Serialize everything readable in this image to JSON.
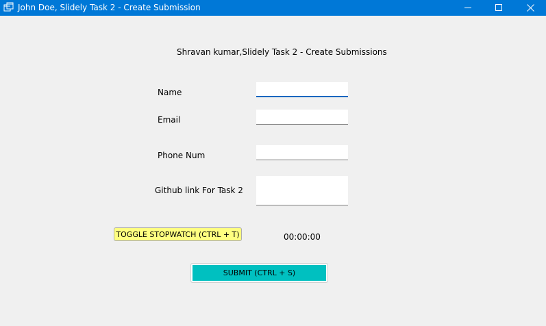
{
  "window": {
    "title": "John Doe, Slidely Task 2 - Create Submission",
    "controls": {
      "minimize_icon": "minimize-icon",
      "maximize_icon": "maximize-icon",
      "close_icon": "close-icon"
    },
    "accent_color": "#0078d7"
  },
  "form": {
    "heading": "Shravan kumar,Slidely Task 2 - Create Submissions",
    "fields": {
      "name": {
        "label": "Name",
        "value": ""
      },
      "email": {
        "label": "Email",
        "value": ""
      },
      "phone": {
        "label": "Phone Num",
        "value": ""
      },
      "github": {
        "label": "Github link For Task 2",
        "value": ""
      }
    },
    "stopwatch": {
      "button_label": "TOGGLE STOPWATCH (CTRL + T)",
      "button_color": "#ffff80",
      "time": "00:00:00"
    },
    "submit": {
      "label": "SUBMIT (CTRL + S)",
      "color": "#00c0c0"
    }
  }
}
